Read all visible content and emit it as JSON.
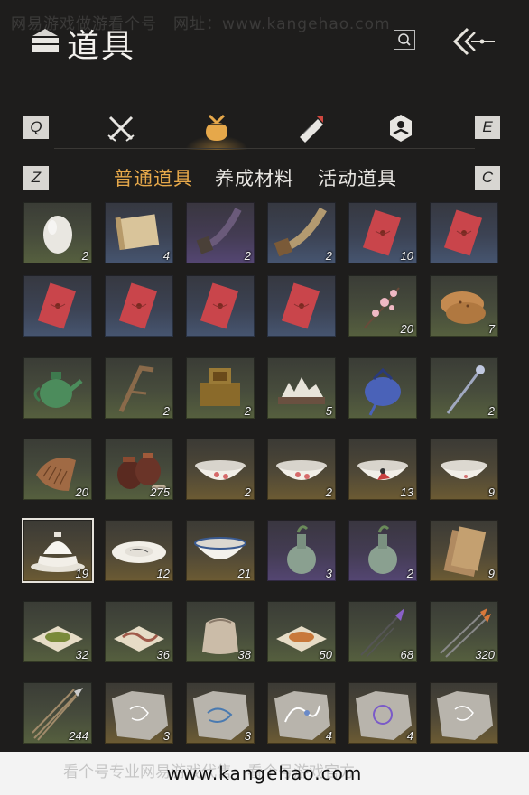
{
  "watermark_top": "网易游戏做游看个号　网址：www.kangehao.com",
  "header": {
    "title": "道具"
  },
  "category_keys": {
    "left": "Q",
    "right": "E",
    "sub_left": "Z",
    "sub_right": "C"
  },
  "category_tabs": [
    {
      "icon": "crossed-swords-icon",
      "active": false
    },
    {
      "icon": "pouch-icon",
      "active": true
    },
    {
      "icon": "scroll-icon",
      "active": false
    },
    {
      "icon": "badge-icon",
      "active": false
    }
  ],
  "sub_tabs": [
    {
      "label": "普通道具",
      "active": true
    },
    {
      "label": "养成材料",
      "active": false
    },
    {
      "label": "活动道具",
      "active": false
    }
  ],
  "colors": {
    "active_tab": "#e6a84a",
    "inactive_tab": "#e8e6e2"
  },
  "items": [
    [
      {
        "icon": "egg-icon",
        "qty": "2",
        "quality": "green"
      },
      {
        "icon": "paper-scroll-icon",
        "qty": "4",
        "quality": "blue"
      },
      {
        "icon": "horn-purple-icon",
        "qty": "2",
        "quality": "purple"
      },
      {
        "icon": "horn-icon",
        "qty": "2",
        "quality": "blue"
      },
      {
        "icon": "red-envelope-icon",
        "qty": "10",
        "quality": "blue"
      },
      {
        "icon": "red-envelope-icon",
        "qty": "",
        "quality": "blue"
      }
    ],
    [
      {
        "icon": "red-envelope-icon",
        "qty": "",
        "quality": "blue"
      },
      {
        "icon": "red-envelope-icon",
        "qty": "",
        "quality": "blue"
      },
      {
        "icon": "red-envelope-icon",
        "qty": "",
        "quality": "blue"
      },
      {
        "icon": "red-envelope-icon",
        "qty": "",
        "quality": "blue"
      },
      {
        "icon": "plum-blossom-icon",
        "qty": "20",
        "quality": "green"
      },
      {
        "icon": "flatbread-icon",
        "qty": "7",
        "quality": "green"
      }
    ],
    [
      {
        "icon": "teapot-icon",
        "qty": "",
        "quality": "green"
      },
      {
        "icon": "wood-frame-icon",
        "qty": "2",
        "quality": "green"
      },
      {
        "icon": "bronze-seal-icon",
        "qty": "2",
        "quality": "green"
      },
      {
        "icon": "rock-garden-icon",
        "qty": "5",
        "quality": "green"
      },
      {
        "icon": "blue-pouch-icon",
        "qty": "",
        "quality": "green"
      },
      {
        "icon": "hairpin-icon",
        "qty": "2",
        "quality": "green"
      }
    ],
    [
      {
        "icon": "wooden-comb-icon",
        "qty": "20",
        "quality": "green"
      },
      {
        "icon": "wine-jars-icon",
        "qty": "275",
        "quality": "green"
      },
      {
        "icon": "flower-bowl-icon",
        "qty": "2",
        "quality": "gold"
      },
      {
        "icon": "flower-bowl-icon",
        "qty": "2",
        "quality": "gold"
      },
      {
        "icon": "rooster-bowl-icon",
        "qty": "13",
        "quality": "gold"
      },
      {
        "icon": "bowl-icon",
        "qty": "9",
        "quality": "gold"
      }
    ],
    [
      {
        "icon": "covered-bowl-icon",
        "qty": "19",
        "quality": "gold",
        "selected": true
      },
      {
        "icon": "plate-icon",
        "qty": "12",
        "quality": "gold"
      },
      {
        "icon": "blue-rim-bowl-icon",
        "qty": "21",
        "quality": "gold"
      },
      {
        "icon": "celadon-vase-icon",
        "qty": "3",
        "quality": "purple"
      },
      {
        "icon": "celadon-vase-icon",
        "qty": "2",
        "quality": "purple"
      },
      {
        "icon": "wooden-slips-icon",
        "qty": "9",
        "quality": "gold"
      }
    ],
    [
      {
        "icon": "green-powder-icon",
        "qty": "32",
        "quality": "green"
      },
      {
        "icon": "earthworm-icon",
        "qty": "36",
        "quality": "green"
      },
      {
        "icon": "cloth-sack-icon",
        "qty": "38",
        "quality": "green"
      },
      {
        "icon": "orange-powder-icon",
        "qty": "50",
        "quality": "green"
      },
      {
        "icon": "purple-dart-icon",
        "qty": "68",
        "quality": "green"
      },
      {
        "icon": "arrows-icon",
        "qty": "320",
        "quality": "green"
      }
    ],
    [
      {
        "icon": "arrows-bundle-icon",
        "qty": "244",
        "quality": "green"
      },
      {
        "icon": "stone-rubbing-icon",
        "qty": "3",
        "quality": "gold"
      },
      {
        "icon": "stone-rubbing-blue-icon",
        "qty": "3",
        "quality": "gold"
      },
      {
        "icon": "stone-rubbing-dragon-icon",
        "qty": "4",
        "quality": "gold"
      },
      {
        "icon": "stone-rubbing-purple-icon",
        "qty": "4",
        "quality": "gold"
      },
      {
        "icon": "stone-rubbing-icon",
        "qty": "",
        "quality": "gold"
      }
    ]
  ],
  "footer": {
    "text": "www.kangehao.com",
    "faded_text": "看个号专业网易游戏代售　看个号游戏官方"
  }
}
